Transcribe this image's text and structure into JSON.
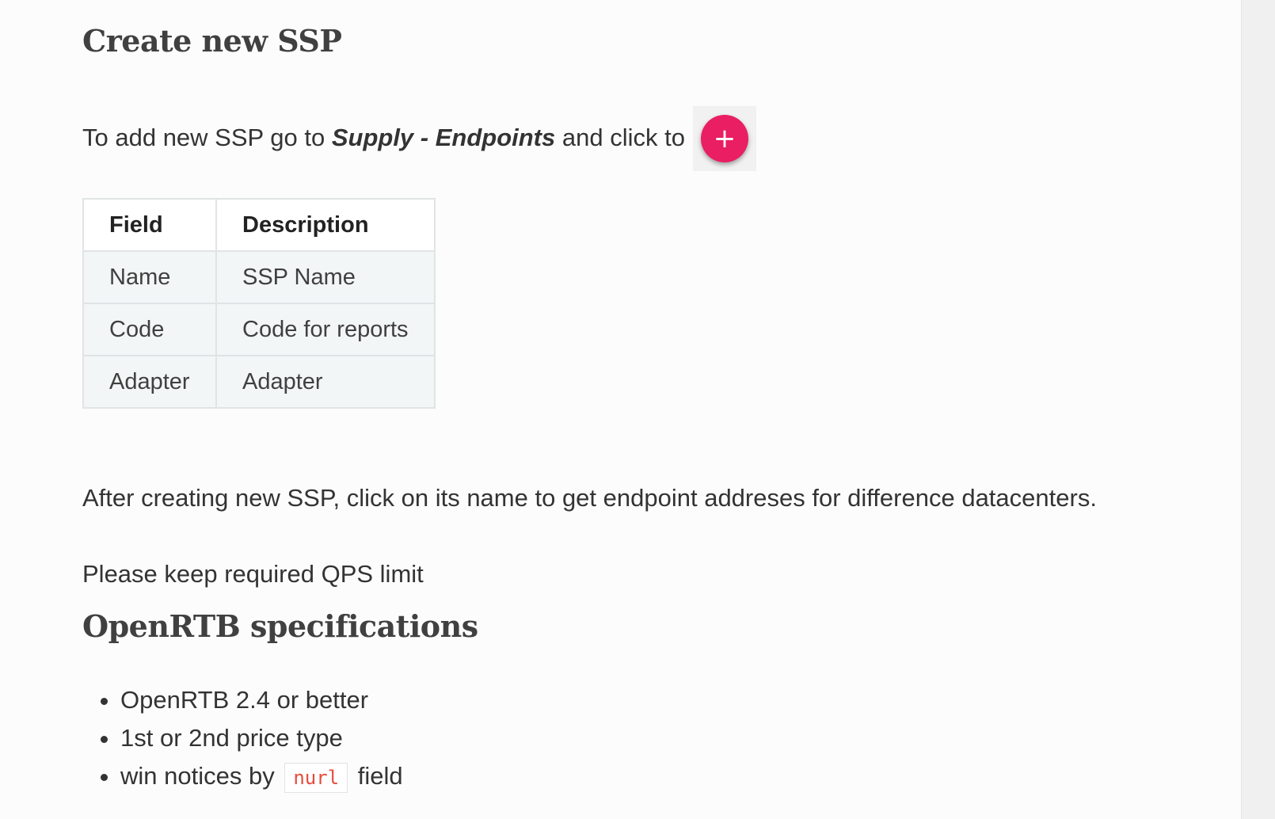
{
  "create_section": {
    "heading": "Create new SSP",
    "intro_before": "To add new SSP go to ",
    "intro_link": "Supply - Endpoints",
    "intro_after": " and click to",
    "add_button_symbol": "+",
    "add_button_color": "#e91e63"
  },
  "fields_table": {
    "headers": [
      "Field",
      "Description"
    ],
    "rows": [
      [
        "Name",
        "SSP Name"
      ],
      [
        "Code",
        "Code for reports"
      ],
      [
        "Adapter",
        "Adapter"
      ]
    ]
  },
  "after_text": "After creating new SSP, click on its name to get endpoint addreses for difference datacenters.",
  "qps_text": "Please keep required QPS limit",
  "openrtb_section": {
    "heading": "OpenRTB specifications",
    "items": [
      "OpenRTB 2.4 or better",
      "1st or 2nd price type"
    ],
    "win_notice_before": "win notices by",
    "win_notice_code": "nurl",
    "win_notice_after": "field"
  }
}
